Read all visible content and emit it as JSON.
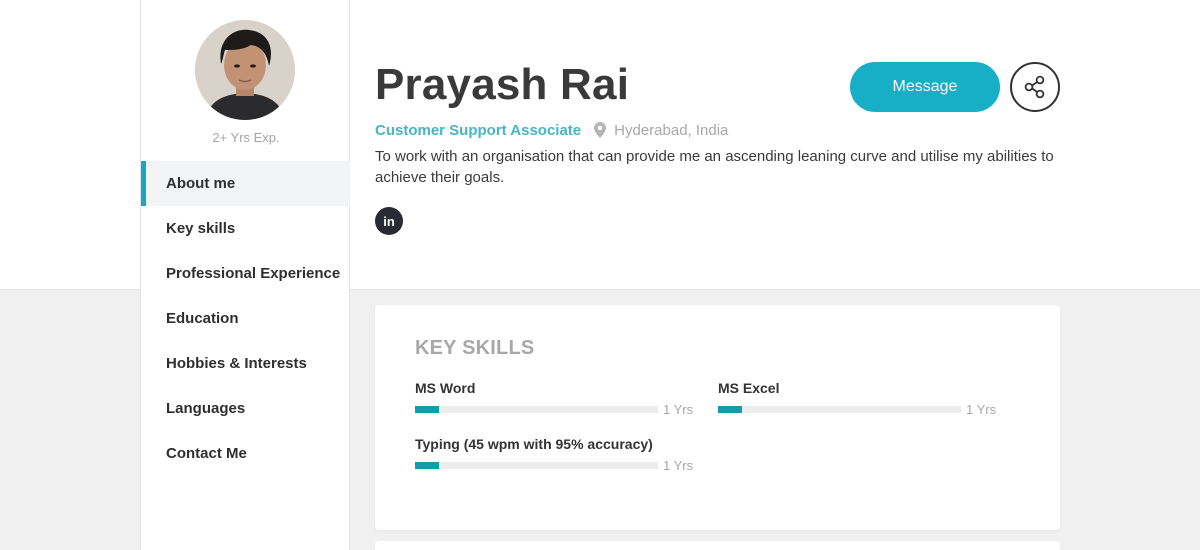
{
  "profile": {
    "experience": "2+ Yrs Exp.",
    "name": "Prayash Rai",
    "job_title": "Customer Support Associate",
    "location": "Hyderabad, India",
    "summary": "To work with an organisation that can provide me an ascending leaning curve and utilise my abilities to achieve their goals.",
    "linkedin_label": "in"
  },
  "actions": {
    "message_label": "Message"
  },
  "sidebar": {
    "items": [
      {
        "label": "About me",
        "active": true
      },
      {
        "label": "Key skills"
      },
      {
        "label": "Professional Experience"
      },
      {
        "label": "Education"
      },
      {
        "label": "Hobbies & Interests"
      },
      {
        "label": "Languages"
      },
      {
        "label": "Contact Me"
      }
    ]
  },
  "key_skills": {
    "heading": "KEY SKILLS",
    "items": [
      {
        "name": "MS Word",
        "years": "1 Yrs",
        "level": 0.1
      },
      {
        "name": "MS Excel",
        "years": "1 Yrs",
        "level": 0.1
      },
      {
        "name": "Typing (45 wpm with 95% accuracy)",
        "years": "1 Yrs",
        "level": 0.1
      }
    ]
  },
  "colors": {
    "accent": "#17aec8",
    "skill_fill": "#179ba8",
    "job_title": "#48b5c5"
  },
  "icons": [
    "location-pin-icon",
    "share-icon",
    "linkedin-icon",
    "avatar-photo"
  ]
}
